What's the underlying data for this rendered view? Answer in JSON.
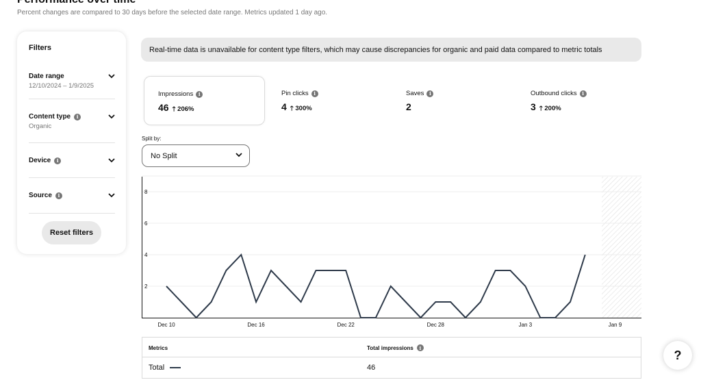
{
  "header": {
    "title": "Performance over time",
    "subtitle": "Percent changes are compared to 30 days before the selected date range. Metrics updated 1 day ago."
  },
  "filters": {
    "title": "Filters",
    "items": [
      {
        "label": "Date range",
        "value": "12/10/2024 – 1/9/2025",
        "info": false
      },
      {
        "label": "Content type",
        "value": "Organic",
        "info": true
      },
      {
        "label": "Device",
        "value": "",
        "info": true
      },
      {
        "label": "Source",
        "value": "",
        "info": true
      }
    ],
    "reset_label": "Reset filters"
  },
  "banner": {
    "text": "Real-time data is unavailable for content type filters, which may cause discrepancies for organic and paid data compared to metric totals"
  },
  "metrics": [
    {
      "name": "Impressions",
      "value": "46",
      "change": "206%",
      "selected": true,
      "has_change": true
    },
    {
      "name": "Pin clicks",
      "value": "4",
      "change": "300%",
      "selected": false,
      "has_change": true
    },
    {
      "name": "Saves",
      "value": "2",
      "change": "",
      "selected": false,
      "has_change": false
    },
    {
      "name": "Outbound clicks",
      "value": "3",
      "change": "200%",
      "selected": false,
      "has_change": true
    }
  ],
  "split": {
    "label": "Split by:",
    "selected": "No Split"
  },
  "chart_data": {
    "type": "line",
    "x": [
      "Dec 10",
      "Dec 11",
      "Dec 12",
      "Dec 13",
      "Dec 14",
      "Dec 15",
      "Dec 16",
      "Dec 17",
      "Dec 18",
      "Dec 19",
      "Dec 20",
      "Dec 21",
      "Dec 22",
      "Dec 23",
      "Dec 24",
      "Dec 25",
      "Dec 26",
      "Dec 27",
      "Dec 28",
      "Dec 29",
      "Dec 30",
      "Dec 31",
      "Jan 1",
      "Jan 2",
      "Jan 3",
      "Jan 4",
      "Jan 5",
      "Jan 6",
      "Jan 7"
    ],
    "values": [
      2,
      1,
      0,
      1,
      3,
      4,
      1,
      3,
      2,
      1,
      3,
      3,
      3,
      0,
      0,
      2,
      1,
      0,
      1,
      1,
      0,
      1,
      3,
      3,
      2,
      0,
      0,
      1,
      4
    ],
    "x_tick_labels": [
      "Dec 10",
      "Dec 16",
      "Dec 22",
      "Dec 28",
      "Jan 3",
      "Jan 9"
    ],
    "y_ticks": [
      2,
      4,
      6,
      8
    ],
    "ylim": [
      0,
      9
    ],
    "line_color": "#2e3a4a",
    "grid": true
  },
  "table": {
    "col1_header": "Metrics",
    "col2_header": "Total impressions",
    "row_label": "Total",
    "row_value": "46"
  },
  "help": {
    "label": "?"
  }
}
